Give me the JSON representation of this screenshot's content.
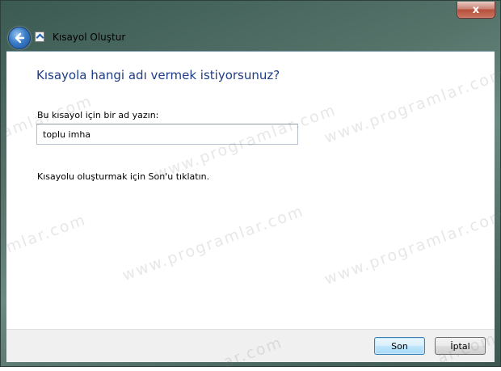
{
  "window": {
    "title": "Kısayol Oluştur",
    "close_glyph": "x"
  },
  "wizard": {
    "heading": "Kısayola hangi adı vermek istiyorsunuz?",
    "field_label": "Bu kısayol için bir ad yazın:",
    "field_value": "toplu imha",
    "instruction": "Kısayolu oluşturmak için Son'u tıklatın."
  },
  "buttons": {
    "finish": "Son",
    "cancel": "İptal"
  },
  "watermark": {
    "text": "www.programlar.com",
    "fragment_left": "ramlar.com",
    "fragment_short": "mlar.com",
    "fragment_bottom": "ar.com"
  },
  "icons": {
    "back": "back-arrow-icon",
    "window": "shortcut-icon",
    "close": "close-icon"
  }
}
